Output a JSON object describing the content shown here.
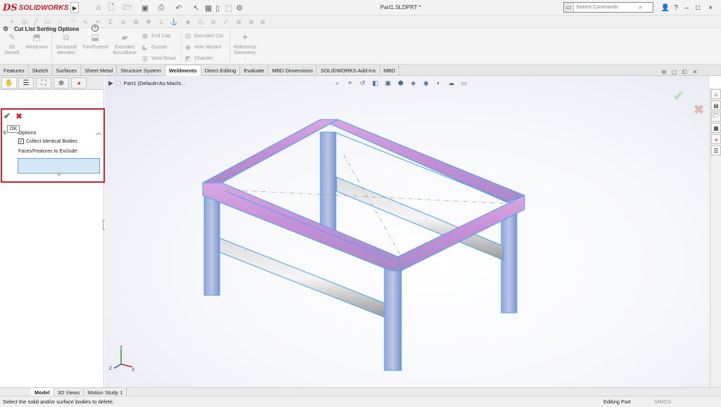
{
  "app": {
    "logo_ds": "DS",
    "logo_text": "SOLIDWORKS",
    "document_title": "Part1.SLDPRT *"
  },
  "search": {
    "placeholder": "Search Commands"
  },
  "window_controls": [
    "?",
    "–",
    "□",
    "×"
  ],
  "command_manager": {
    "big_buttons": [
      {
        "label": "3D\nSketch",
        "icon": "sketch-3d-icon"
      },
      {
        "label": "Weldment",
        "icon": "weldment-icon"
      },
      {
        "label": "Structural\nMember",
        "icon": "structural-member-icon"
      },
      {
        "label": "Trim/Extend",
        "icon": "trim-extend-icon"
      },
      {
        "label": "Extruded\nBoss/Base",
        "icon": "extruded-boss-icon"
      }
    ],
    "col1": [
      "End Cap",
      "Gusset",
      "Weld Bead"
    ],
    "col2": [
      "Extruded Cut",
      "Hole Wizard",
      "Chamfer"
    ],
    "reference_geometry": "Reference\nGeometry"
  },
  "tabs": [
    {
      "label": "Features",
      "active": false
    },
    {
      "label": "Sketch",
      "active": false
    },
    {
      "label": "Surfaces",
      "active": false
    },
    {
      "label": "Sheet Metal",
      "active": false
    },
    {
      "label": "Structure System",
      "active": false
    },
    {
      "label": "Weldments",
      "active": true
    },
    {
      "label": "Direct Editing",
      "active": false
    },
    {
      "label": "Evaluate",
      "active": false
    },
    {
      "label": "MBD Dimensions",
      "active": false
    },
    {
      "label": "SOLIDWORKS Add-Ins",
      "active": false
    },
    {
      "label": "MBD",
      "active": false
    }
  ],
  "property_manager": {
    "title": "Cut List Sorting Options",
    "help": "?",
    "ok_symbol": "✔",
    "cancel_symbol": "✖",
    "ok_tooltip": "OK",
    "group_title": "S        Options",
    "collect_identical_bodies": {
      "label": "Collect Identical Bodies",
      "checked": true
    },
    "faces_label": "Faces/Features to Exclude:"
  },
  "viewport": {
    "tree_item": "Part1  (Default<As Machi..."
  },
  "bottom_tabs": [
    {
      "label": "Model",
      "active": true
    },
    {
      "label": "3D Views",
      "active": false
    },
    {
      "label": "Motion Study 1",
      "active": false
    }
  ],
  "status": {
    "message": "Select the solid and/or surface bodies to delete.",
    "mode": "Editing Part",
    "units": "MMGS"
  },
  "triad": {
    "x": "X",
    "y": "Y",
    "z": "Z"
  },
  "colors": {
    "brand_red": "#d0161b",
    "highlight_red": "#d7202a",
    "ok_green": "#1f9d22",
    "selection_blue": "#5aa8ef",
    "frame_pink": "#c98fd8"
  }
}
